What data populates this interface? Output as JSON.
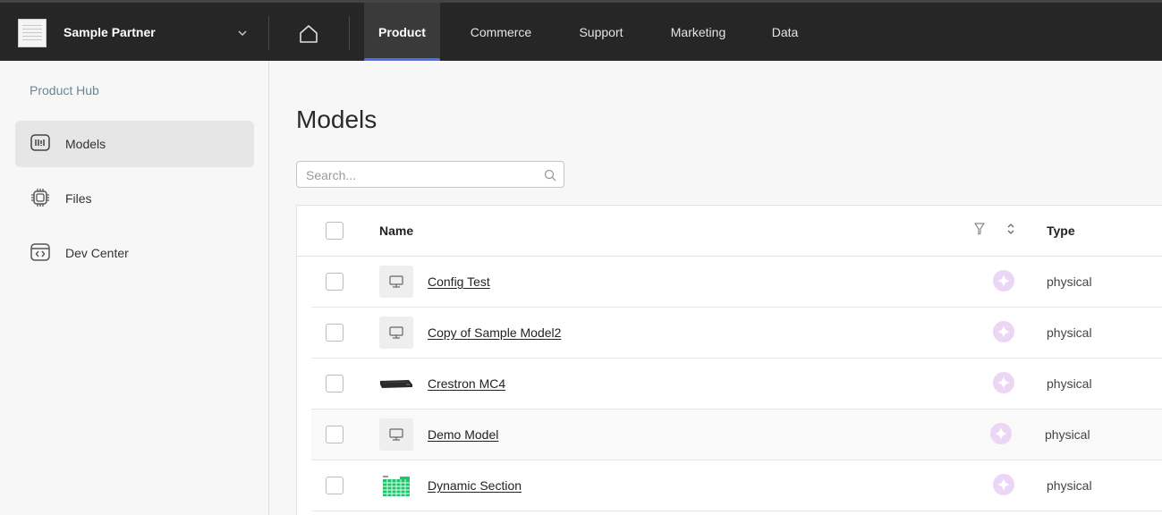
{
  "header": {
    "partner_name": "Sample Partner",
    "nav_tabs": [
      {
        "label": "Product",
        "active": true
      },
      {
        "label": "Commerce",
        "active": false
      },
      {
        "label": "Support",
        "active": false
      },
      {
        "label": "Marketing",
        "active": false
      },
      {
        "label": "Data",
        "active": false
      }
    ]
  },
  "sidebar": {
    "title": "Product Hub",
    "items": [
      {
        "label": "Models",
        "icon": "models-icon",
        "active": true
      },
      {
        "label": "Files",
        "icon": "chip-icon",
        "active": false
      },
      {
        "label": "Dev Center",
        "icon": "code-window-icon",
        "active": false
      }
    ]
  },
  "main": {
    "title": "Models",
    "search": {
      "placeholder": "Search...",
      "value": ""
    },
    "table": {
      "columns": {
        "name": "Name",
        "type": "Type"
      },
      "rows": [
        {
          "name": "Config Test",
          "type": "physical",
          "thumb": "monitor-placeholder-icon"
        },
        {
          "name": "Copy of Sample Model2",
          "type": "physical",
          "thumb": "monitor-placeholder-icon"
        },
        {
          "name": "Crestron MC4",
          "type": "physical",
          "thumb": "device-photo"
        },
        {
          "name": "Demo Model",
          "type": "physical",
          "thumb": "monitor-placeholder-icon"
        },
        {
          "name": "Dynamic Section",
          "type": "physical",
          "thumb": "green-grid-image"
        }
      ]
    }
  },
  "colors": {
    "topbar": "#262626",
    "active_tab_indicator": "#4b6fe8",
    "sparkle": "#e3c6f0"
  }
}
